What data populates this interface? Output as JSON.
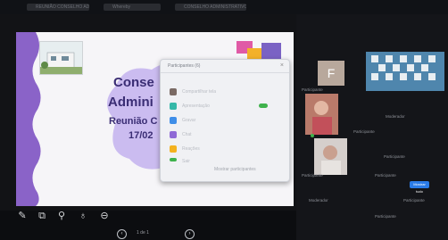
{
  "browser_tabs": [
    {
      "label": "REUNIÃO CONSELHO ADM"
    },
    {
      "label": "Whereby"
    },
    {
      "label": "CONSELHO ADMINISTRATIVO"
    }
  ],
  "slide": {
    "title_line1": "Conse",
    "title_line2": "Admini",
    "subtitle": "Reunião C",
    "date": "17/02",
    "colors": {
      "purple": "#8a63c8",
      "lilac": "#cbbcf0",
      "navy": "#3a2d74"
    }
  },
  "popup": {
    "title": "Participantes (6)",
    "rows": [
      {
        "label": "Compartilhar tela",
        "color": "#7a6a64"
      },
      {
        "label": "Apresentação",
        "color": "#35b8a8"
      },
      {
        "label": "Gravar",
        "color": "#3f8ee8"
      },
      {
        "label": "Chat",
        "color": "#8f6ad6"
      },
      {
        "label": "Reações",
        "color": "#f4b21f"
      },
      {
        "label": "Sair",
        "color": "#3fb24c"
      }
    ],
    "footer": "Mostrar participantes"
  },
  "toolbar": {
    "icons": [
      "pen-icon",
      "layout-icon",
      "zoom-icon",
      "lock-icon",
      "close-icon"
    ],
    "glyphs": [
      "✎",
      "⧉",
      "⚲",
      "♁",
      "⊖"
    ]
  },
  "participants": {
    "avatar_letter": "F",
    "names": [
      "Participante",
      "Moderador",
      "Participante",
      "Participante",
      "Participante",
      "Participante"
    ],
    "button": "Mostrar tudo",
    "footer_names": [
      "Moderador",
      "Participante",
      "Participante"
    ]
  },
  "pager": {
    "label": "1 de 1",
    "prev": "‹",
    "next": "›"
  }
}
